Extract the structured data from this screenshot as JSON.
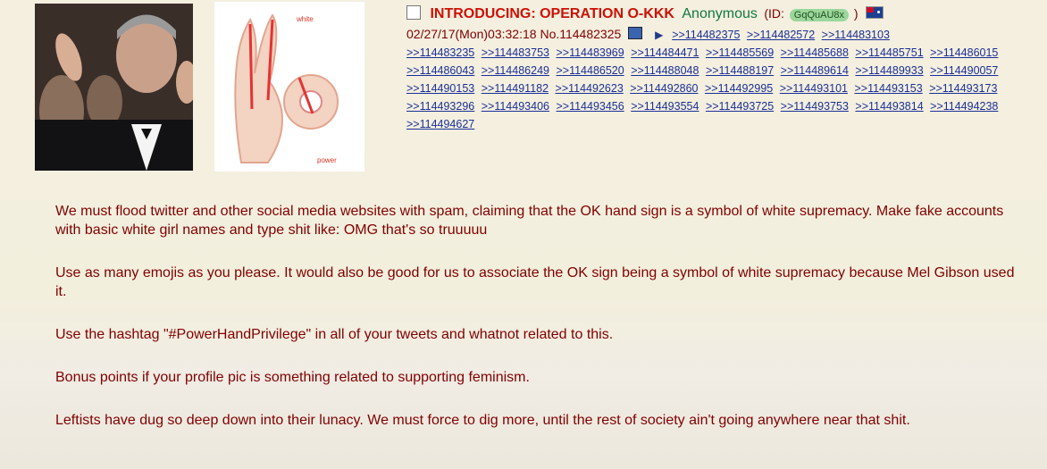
{
  "post": {
    "subject": "INTRODUCING: OPERATION O-KKK",
    "name": "Anonymous",
    "id_label_open": "(ID:",
    "id_value": "GqQuAU8x",
    "id_label_close": ")",
    "date": "02/27/17(Mon)03:32:18",
    "number": "No.114482325",
    "flag_icon": "flag-icon",
    "thumb1_icon": "photo-thumbnail-icon",
    "thumb2_icon": "ok-hand-diagram-icon",
    "thumb2_label_top": "white",
    "thumb2_label_bottom": "power"
  },
  "backlinks": [
    ">>114482375",
    ">>114482572",
    ">>114483103",
    ">>114483235",
    ">>114483753",
    ">>114483969",
    ">>114484471",
    ">>114485569",
    ">>114485688",
    ">>114485751",
    ">>114486015",
    ">>114486043",
    ">>114486249",
    ">>114486520",
    ">>114488048",
    ">>114488197",
    ">>114489614",
    ">>114489933",
    ">>114490057",
    ">>114490153",
    ">>114491182",
    ">>114492623",
    ">>114492860",
    ">>114492995",
    ">>114493101",
    ">>114493153",
    ">>114493173",
    ">>114493296",
    ">>114493406",
    ">>114493456",
    ">>114493554",
    ">>114493725",
    ">>114493753",
    ">>114493814",
    ">>114494238",
    ">>114494627"
  ],
  "paragraphs": [
    "We must flood twitter and other social media websites with spam, claiming that the OK hand sign is a symbol of white supremacy. Make fake accounts with basic white girl names and type shit like: OMG that's so truuuuu",
    "Use as many emojis as you please. It would also be good for us to associate the OK sign being a symbol of white supremacy because Mel Gibson used it.",
    "Use the hashtag \"#PowerHandPrivilege\" in all of your tweets and whatnot related to this.",
    "Bonus points if your profile pic is something related to supporting feminism.",
    "Leftists have dug so deep down into their lunacy. We must force to dig more, until the rest of society ain't going anywhere near that shit."
  ],
  "colors": {
    "subject": "#cc1105",
    "name": "#117743",
    "body_text": "#800000",
    "link": "#1a2f9a",
    "background": "#f3efdd"
  }
}
